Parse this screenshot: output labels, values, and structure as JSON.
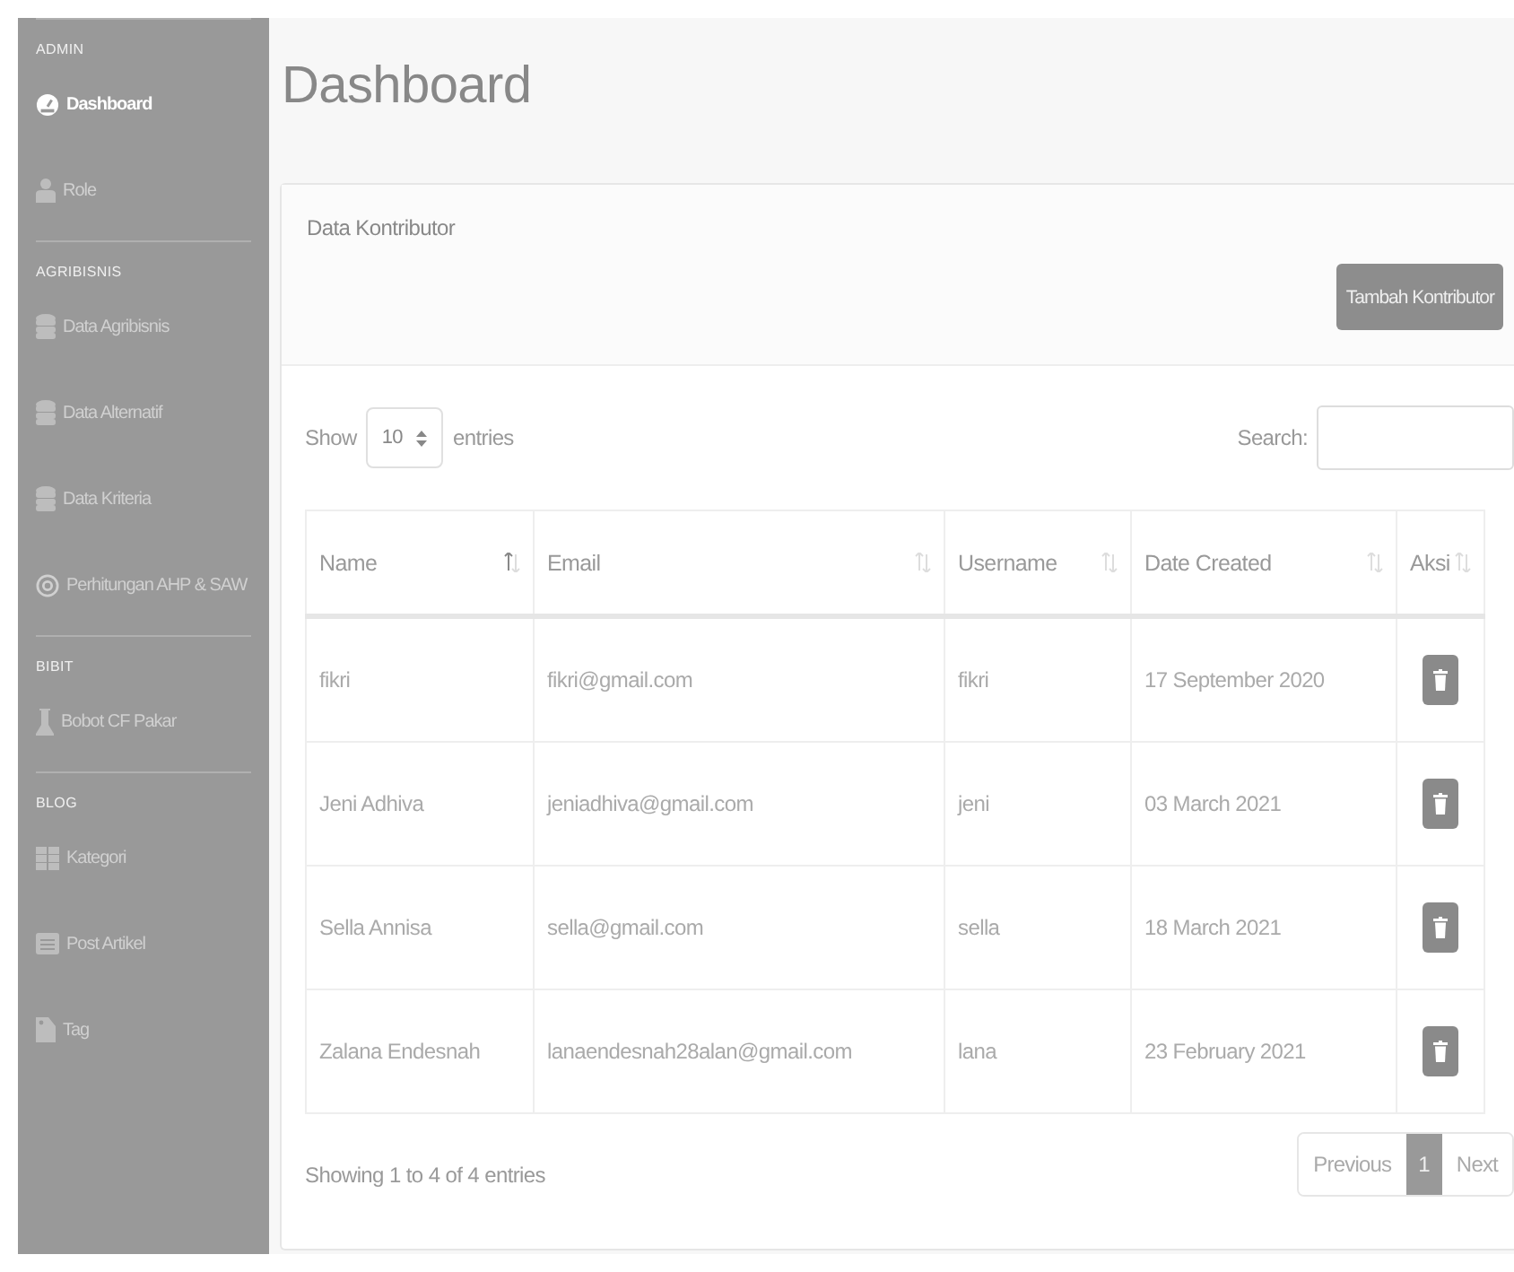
{
  "sidebar": {
    "sections": [
      {
        "header": "ADMIN",
        "items": [
          {
            "label": "Dashboard",
            "selected": true
          },
          {
            "label": "Role",
            "selected": false
          }
        ]
      },
      {
        "header": "AGRIBISNIS",
        "items": [
          {
            "label": "Data Agribisnis",
            "selected": false
          },
          {
            "label": "Data Alternatif",
            "selected": false
          },
          {
            "label": "Data Kriteria",
            "selected": false
          },
          {
            "label": "Perhitungan AHP & SAW",
            "selected": false
          }
        ]
      },
      {
        "header": "BIBIT",
        "items": [
          {
            "label": "Bobot CF Pakar",
            "selected": false
          }
        ]
      },
      {
        "header": "BLOG",
        "items": [
          {
            "label": "Kategori",
            "selected": false
          },
          {
            "label": "Post Artikel",
            "selected": false
          },
          {
            "label": "Tag",
            "selected": false
          }
        ]
      }
    ]
  },
  "page_title": "Dashboard",
  "card": {
    "title": "Data Kontributor",
    "add_button": "Tambah Kontributor",
    "length_label_before": "Show",
    "length_value": "10",
    "length_label_after": "entries",
    "search_label": "Search:",
    "table": {
      "columns": [
        {
          "label": "Name",
          "sorted": true
        },
        {
          "label": "Email",
          "sorted": false
        },
        {
          "label": "Username",
          "sorted": false
        },
        {
          "label": "Date Created",
          "sorted": false
        },
        {
          "label": "Aksi",
          "sorted": false
        }
      ],
      "rows": [
        [
          "fikri",
          "fikri@gmail.com",
          "fikri",
          "17 September 2020"
        ],
        [
          "Jeni Adhiva",
          "jeniadhiva@gmail.com",
          "jeni",
          "03 March 2021"
        ],
        [
          "Sella Annisa",
          "sella@gmail.com",
          "sella",
          "18 March 2021"
        ],
        [
          "Zalana Endesnah",
          "lanaendesnah28alan@gmail.com",
          "lana",
          "23 February 2021"
        ]
      ]
    },
    "info": "Showing 1 to 4 of 4 entries",
    "pagination": [
      {
        "label": "Previous",
        "selected": false
      },
      {
        "label": "1",
        "selected": true
      },
      {
        "label": "Next",
        "selected": false
      }
    ]
  }
}
